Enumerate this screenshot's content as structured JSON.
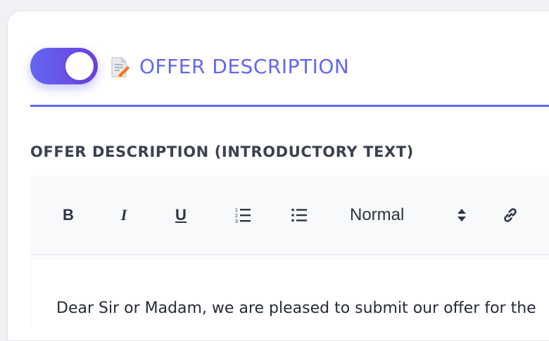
{
  "section": {
    "title": "OFFER DESCRIPTION",
    "toggle_on": true,
    "icon": "memo-icon"
  },
  "field": {
    "label": "OFFER DESCRIPTION (INTRODUCTORY TEXT)"
  },
  "toolbar": {
    "bold_label": "B",
    "italic_label": "I",
    "underline_label": "U",
    "ordered_list_icon": "ordered-list-icon",
    "bullet_list_icon": "bullet-list-icon",
    "format_select_value": "Normal",
    "link_icon": "link-icon"
  },
  "editor": {
    "content": "Dear Sir or Madam, we are pleased to submit our offer for the"
  },
  "colors": {
    "accent": "#6366f1",
    "accent_dark": "#6d3fe0",
    "label_text": "#3b4150",
    "toolbar_bg": "#f8f9fb"
  }
}
